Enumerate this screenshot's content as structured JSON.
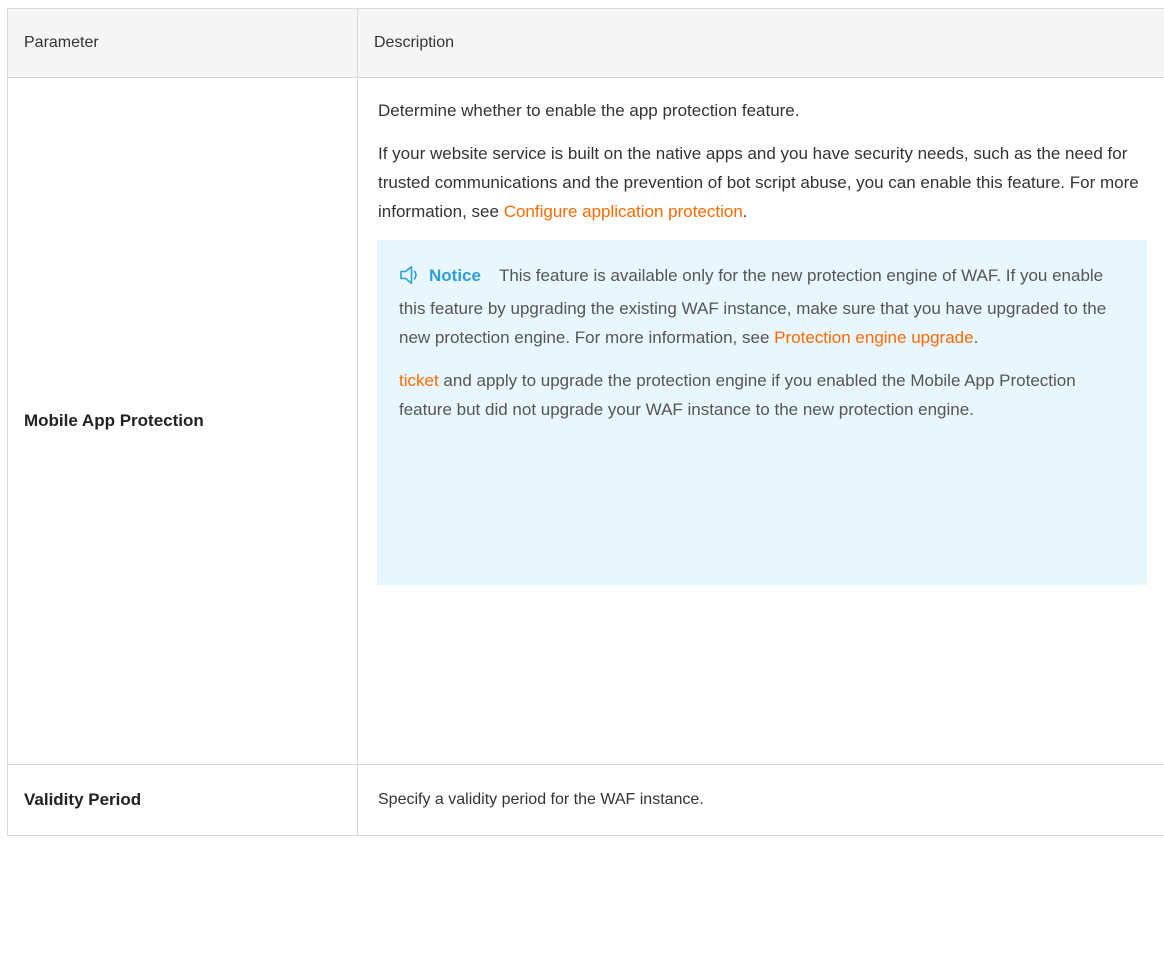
{
  "table": {
    "headers": {
      "parameter": "Parameter",
      "description": "Description"
    },
    "rows": [
      {
        "name": "Mobile App Protection",
        "intro": "Determine whether to enable the app protection feature.",
        "detail_text": "If your website service is built on the native apps and you have security needs, such as the need for trusted communications and the prevention of bot script abuse, you can enable this feature. For more information, see",
        "detail_link": "Configure application protection",
        "detail_end": ".",
        "notice": {
          "icon": "speaker-icon",
          "title": "Notice",
          "text": "This feature is available only for the new protection engine of WAF. If you enable this feature by upgrading the existing WAF instance, make sure that you have upgraded to the new protection engine. For more information, see",
          "link": "Protection engine upgrade",
          "text_end": ".",
          "ticket_link": "ticket",
          "ticket_text": "and apply to upgrade the protection engine if you enabled the Mobile App Protection feature but did not upgrade your WAF instance to the new protection engine."
        }
      },
      {
        "name": "Validity Period",
        "description": "Specify a validity period for the WAF instance."
      }
    ]
  },
  "colors": {
    "link": "#ff6a00",
    "notice_accent": "#2d9fd8",
    "notice_background": "#e8f6fd",
    "border": "#d9d9d9",
    "header_background": "#f5f5f5"
  }
}
